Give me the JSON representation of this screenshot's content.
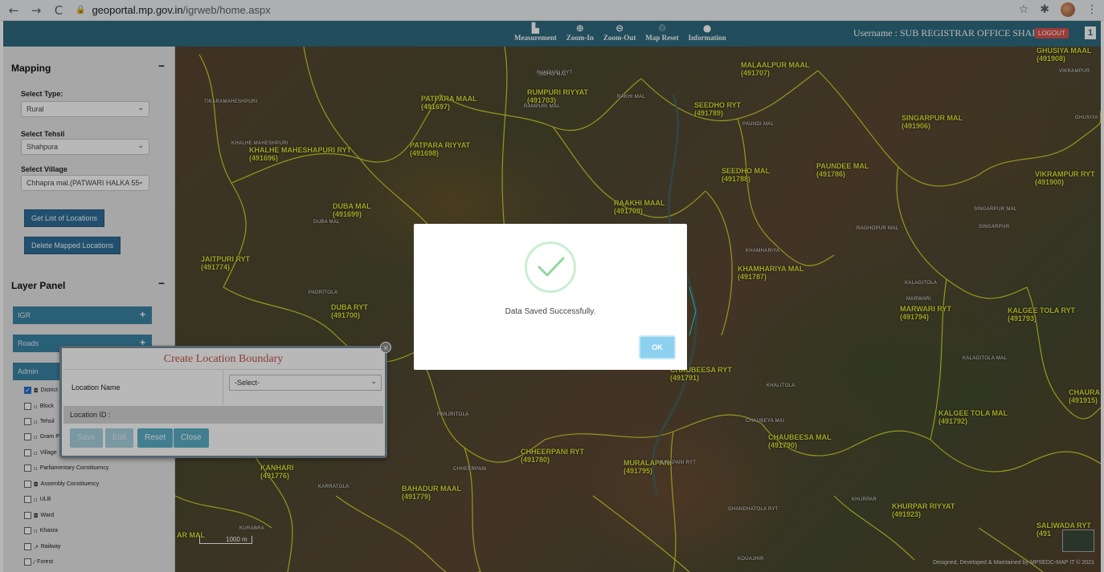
{
  "browser": {
    "url_host": "geoportal.mp.gov.in",
    "url_path": "/igrweb/home.aspx"
  },
  "topbar": {
    "tools": [
      {
        "label": "Measurement",
        "icon": "ruler-icon"
      },
      {
        "label": "Zoom-In",
        "icon": "zoom-in-icon"
      },
      {
        "label": "Zoom-Out",
        "icon": "zoom-out-icon"
      },
      {
        "label": "Map Reset",
        "icon": "recycle-icon"
      },
      {
        "label": "Information",
        "icon": "info-icon"
      }
    ],
    "username": "Username : SUB REGISTRAR OFFICE SHAHPURA",
    "logout": "LOGOUT",
    "menu_glyph": "1"
  },
  "sidebar": {
    "mapping_title": "Mapping",
    "select_type_label": "Select Type:",
    "select_type_value": "Rural",
    "select_tehsil_label": "Select Tehsil",
    "select_tehsil_value": "Shahpura",
    "select_village_label": "Select Village",
    "select_village_value": "Chhapra mal.(PATWARI HALKA 55",
    "get_list_btn": "Get List of Locations",
    "delete_btn": "Delete Mapped Locations",
    "layer_panel_title": "Layer Panel",
    "layer_groups": [
      "IGR",
      "Roads",
      "Admin"
    ],
    "layers": [
      {
        "label": "District",
        "checked": true
      },
      {
        "label": "Block",
        "checked": false
      },
      {
        "label": "Tehsil",
        "checked": false
      },
      {
        "label": "Gram P",
        "checked": false
      },
      {
        "label": "Village",
        "checked": false
      },
      {
        "label": "Parliamentary Constituency",
        "checked": false
      },
      {
        "label": "Assembly Constituency",
        "checked": false
      },
      {
        "label": "ULB",
        "checked": false
      },
      {
        "label": "Ward",
        "checked": false
      },
      {
        "label": "Khasra",
        "checked": false
      },
      {
        "label": "Railway",
        "checked": false
      },
      {
        "label": "Forest",
        "checked": false
      }
    ]
  },
  "map": {
    "places": [
      {
        "name": "PATPARA MAAL",
        "code": "(491697)"
      },
      {
        "name": "RUMPURI RIYYAT",
        "code": "(491703)"
      },
      {
        "name": "SEEDHO RYT",
        "code": "(491789)"
      },
      {
        "name": "MALAALPUR MAAL",
        "code": "(491707)"
      },
      {
        "name": "GHUSIYA MAAL",
        "code": "(491908)"
      },
      {
        "name": "KHALHE MAHESHAPURI RYT",
        "code": "(491696)"
      },
      {
        "name": "PATPARA RIYYAT",
        "code": "(491698)"
      },
      {
        "name": "SINGARPUR MAL",
        "code": "(491906)"
      },
      {
        "name": "SEEDHO MAL",
        "code": "(491788)"
      },
      {
        "name": "PAUNDEE MAL",
        "code": "(491786)"
      },
      {
        "name": "VIKRAMPUR RYT",
        "code": "(491900)"
      },
      {
        "name": "DUBA MAL",
        "code": "(491699)"
      },
      {
        "name": "RAAKHI MAAL",
        "code": "(491709)"
      },
      {
        "name": "JAITPURI RYT",
        "code": "(491774)"
      },
      {
        "name": "KHAMHARIYA MAL",
        "code": "(491787)"
      },
      {
        "name": "DUBA RYT",
        "code": "(491700)"
      },
      {
        "name": "MARWARI RYT",
        "code": "(491794)"
      },
      {
        "name": "KALGEE TOLA RYT",
        "code": "(491793)"
      },
      {
        "name": "CHAUBEESA RYT",
        "code": "(491791)"
      },
      {
        "name": "CHAURA",
        "code": "(491915)"
      },
      {
        "name": "KALGEE TOLA MAL",
        "code": "(491792)"
      },
      {
        "name": "CHAUBEESA MAL",
        "code": "(491790)"
      },
      {
        "name": "CHHEERPANI RYT",
        "code": "(491780)"
      },
      {
        "name": "KANHARI",
        "code": "(491776)"
      },
      {
        "name": "MURALAPANI",
        "code": "(491795)"
      },
      {
        "name": "BAHADUR MAAL",
        "code": "(491779)"
      },
      {
        "name": "KHURPAR RIYYAT",
        "code": "(491923)"
      },
      {
        "name": "SALIWADA RYT",
        "code": "(491"
      },
      {
        "name": "AR MAL",
        "code": ""
      }
    ],
    "village_labels": [
      "RAMPURI RYT",
      "TIKARAMAHESHPURI",
      "SIDHO MAL",
      "RAKHI MAL",
      "RAMPURI MAL",
      "KHALHE MAHESHPURI",
      "PAUNDI MAL",
      "GHUSIYA",
      "VIKRAMPUR",
      "DUBA MAL",
      "SINGARPUR MAL",
      "SINGARPUR",
      "RAGHOPUR MAL",
      "KHAMHARIYA",
      "PADRITOLA",
      "KALAGITOLA",
      "MARWARI",
      "KALAGITOLA MAL",
      "KHALITOLA",
      "PANJRITOLA",
      "CHAUBEYA MAI",
      "CHHEERPANI",
      "MURAPANI RYT",
      "KARRATOLA",
      "GHANDHATOLA RYT",
      "KHURPAR",
      "KURABRA",
      "KOUAJHIR"
    ],
    "scale_label": "1000 m",
    "credit": "Designed, Developed & Maintained by MPSEDC-MAP IT © 2021"
  },
  "modal": {
    "message": "Data Saved Successfully.",
    "ok": "OK"
  },
  "boundary_dialog": {
    "title": "Create Location Boundary",
    "location_name_label": "Location Name",
    "location_select_value": "-Select-",
    "location_id_label": "Location ID :",
    "buttons": {
      "save": "Save",
      "edit": "Edit",
      "reset": "Reset",
      "close": "Close"
    },
    "close_glyph": "✕"
  },
  "colors": {
    "topbar": "#2e6b80",
    "boundary": "#e0e02a",
    "accent_btn": "#2f6f9a",
    "ok_btn": "#8dd0f0"
  }
}
